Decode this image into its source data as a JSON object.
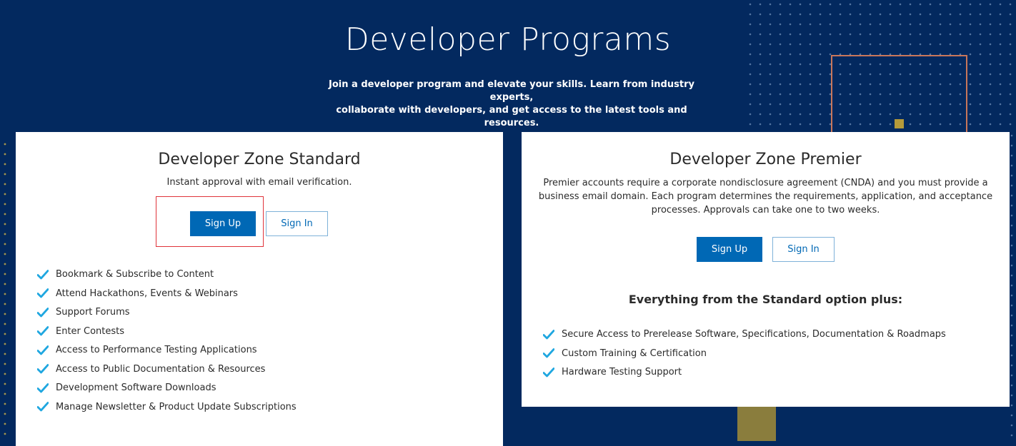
{
  "hero": {
    "title": "Developer Programs",
    "subtitle_line1": "Join a developer program and elevate your skills. Learn from industry experts,",
    "subtitle_line2": "collaborate with developers, and get access to the latest tools and resources."
  },
  "standard": {
    "title": "Developer Zone Standard",
    "description": "Instant approval with email verification.",
    "sign_up_label": "Sign Up",
    "sign_in_label": "Sign In",
    "features": [
      "Bookmark & Subscribe to Content",
      "Attend Hackathons, Events & Webinars",
      "Support Forums",
      "Enter Contests",
      "Access to Performance Testing Applications",
      "Access to Public Documentation & Resources",
      "Development Software Downloads",
      "Manage Newsletter & Product Update Subscriptions"
    ]
  },
  "premier": {
    "title": "Developer Zone Premier",
    "description_line1": "Premier accounts require a corporate nondisclosure agreement (CNDA) and you must provide a",
    "description_line2": "business email domain. Each program determines the requirements, application, and acceptance",
    "description_line3": "processes. Approvals can take one to two weeks.",
    "sign_up_label": "Sign Up",
    "sign_in_label": "Sign In",
    "plus_heading": "Everything from the Standard option plus:",
    "features": [
      "Secure Access to Prerelease Software, Specifications, Documentation & Roadmaps",
      "Custom Training & Certification",
      "Hardware Testing Support"
    ]
  },
  "icons": {
    "feature_bullet": "check-icon"
  },
  "colors": {
    "background": "#03295f",
    "primary_button": "#0068b5",
    "check": "#1fa7e0",
    "accent_outline": "#c8765a",
    "accent_block": "#8a7d3d",
    "highlight": "#e0333a"
  }
}
